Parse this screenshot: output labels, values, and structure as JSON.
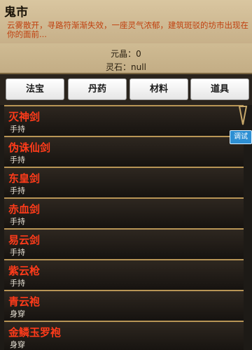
{
  "header": {
    "title": "鬼市",
    "intro": "云雾散开，寻路符渐渐失效，一座灵气浓郁，建筑斑驳的坊市出现在你的面前..."
  },
  "resources": {
    "yuanjing": "元晶：0",
    "lingshi": "灵石：null"
  },
  "tabs": [
    "法宝",
    "丹药",
    "材料",
    "道具"
  ],
  "items": [
    {
      "name": "灭神剑",
      "type": "手持"
    },
    {
      "name": "伪诛仙剑",
      "type": "手持"
    },
    {
      "name": "东皇剑",
      "type": "手持"
    },
    {
      "name": "赤血剑",
      "type": "手持"
    },
    {
      "name": "易云剑",
      "type": "手持"
    },
    {
      "name": "紫云枪",
      "type": "手持"
    },
    {
      "name": "青云袍",
      "type": "身穿"
    },
    {
      "name": "金鳞玉罗袍",
      "type": "身穿"
    }
  ],
  "debug_label": "调试",
  "colors": {
    "accent": "#ff3b1a",
    "intro": "#c0410f",
    "debug": "#2d8fd3"
  }
}
